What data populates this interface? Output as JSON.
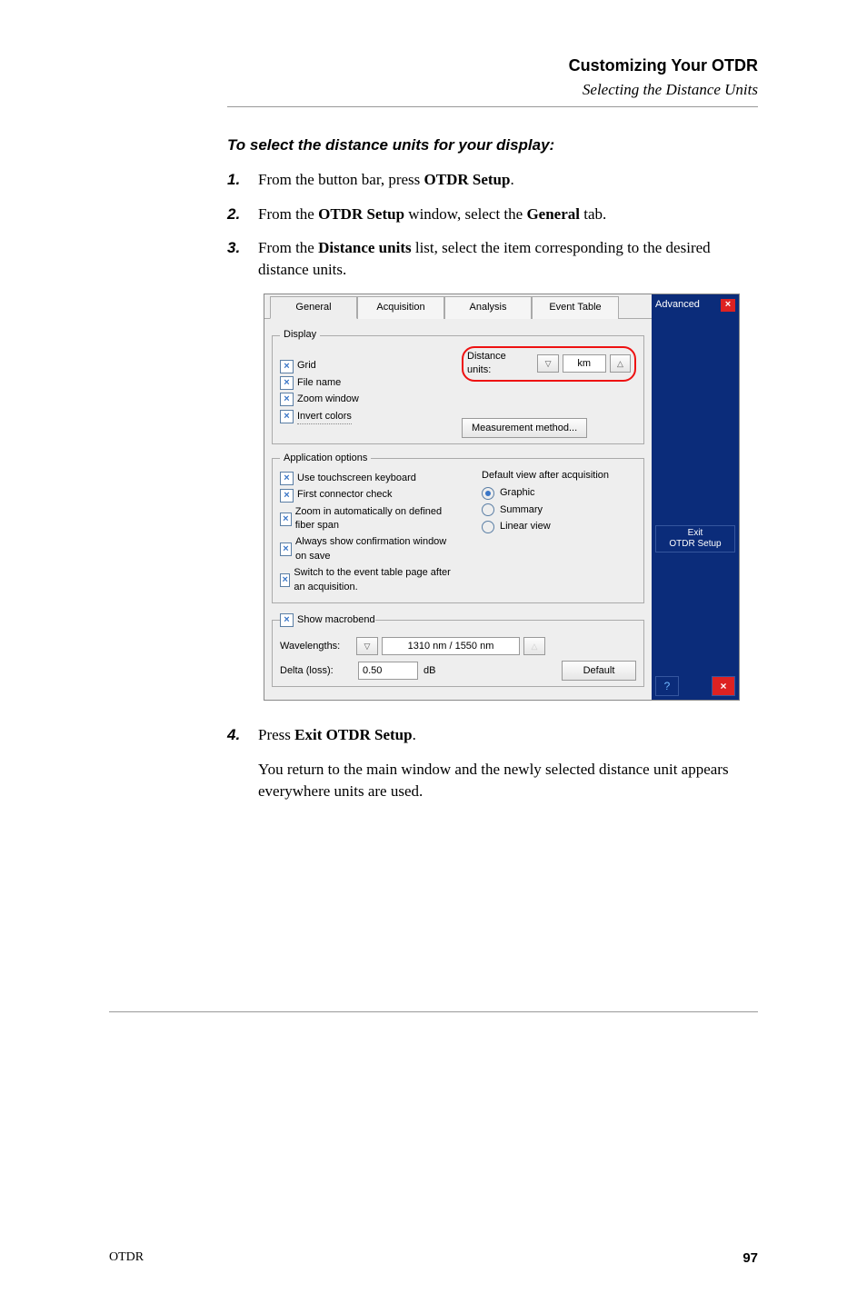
{
  "header": {
    "title": "Customizing Your OTDR",
    "subtitle": "Selecting the Distance Units"
  },
  "intro": "To select the distance units for your display:",
  "steps": {
    "s1": {
      "num": "1.",
      "pre": "From the button bar, press ",
      "bold": "OTDR Setup",
      "post": "."
    },
    "s2": {
      "num": "2.",
      "pre": "From the ",
      "b1": "OTDR Setup",
      "mid": " window, select the ",
      "b2": "General",
      "post": " tab."
    },
    "s3": {
      "num": "3.",
      "pre": "From the ",
      "b1": "Distance units",
      "post": " list, select the item corresponding to the desired distance units."
    },
    "s4": {
      "num": "4.",
      "pre": "Press ",
      "b1": "Exit OTDR Setup",
      "post": "."
    },
    "s4b": "You return to the main window and the newly selected distance unit appears everywhere units are used."
  },
  "panel": {
    "tabs": {
      "general": "General",
      "acquisition": "Acquisition",
      "analysis": "Analysis",
      "event": "Event Table"
    },
    "display": {
      "legend": "Display",
      "grid": "Grid",
      "filename": "File name",
      "zoomwin": "Zoom window",
      "invert": "Invert colors",
      "dist_label": "Distance units:",
      "dist_value": "km",
      "meas_method": "Measurement method..."
    },
    "app": {
      "legend": "Application options",
      "c1": "Use touchscreen keyboard",
      "c2": "First connector check",
      "c3": "Zoom in automatically on defined fiber span",
      "c4": "Always show confirmation window on save",
      "c5": "Switch to the event table page after an acquisition.",
      "def_label": "Default view after acquisition",
      "r1": "Graphic",
      "r2": "Summary",
      "r3": "Linear view"
    },
    "macro": {
      "chk": "Show macrobend",
      "wave_label": "Wavelengths:",
      "wave_value": "1310 nm / 1550 nm",
      "delta_label": "Delta (loss):",
      "delta_value": "0.50",
      "delta_unit": "dB",
      "default_btn": "Default"
    },
    "sidebar": {
      "advanced": "Advanced",
      "exit1": "Exit",
      "exit2": "OTDR Setup"
    }
  },
  "footer": {
    "left": "OTDR",
    "right": "97"
  }
}
